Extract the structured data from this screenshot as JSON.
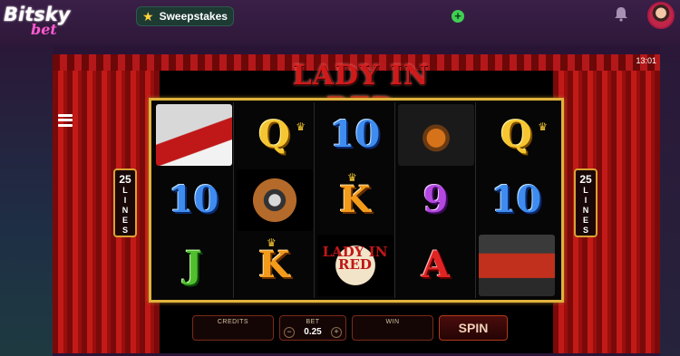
{
  "header": {
    "logo_main": "Bitsky",
    "logo_sub": "bet",
    "sweepstakes_label": "Sweepstakes",
    "add_label": "+",
    "icons": [
      "star-icon",
      "plus-icon",
      "bell-icon",
      "avatar"
    ]
  },
  "game": {
    "title": "LADY IN RED",
    "clock": "13:01",
    "lines_left": {
      "number": "25",
      "word": [
        "L",
        "I",
        "N",
        "E",
        "S"
      ]
    },
    "lines_right": {
      "number": "25",
      "word": [
        "L",
        "I",
        "N",
        "E",
        "S"
      ]
    },
    "reels": [
      [
        {
          "symbol": "roses-symbol",
          "text": ""
        },
        {
          "symbol": "ten",
          "text": "10",
          "color": "blue"
        },
        {
          "symbol": "jack",
          "text": "J",
          "color": "green"
        }
      ],
      [
        {
          "symbol": "queen",
          "text": "Q",
          "color": "gold"
        },
        {
          "symbol": "camera-symbol",
          "text": ""
        },
        {
          "symbol": "king",
          "text": "K",
          "color": "orange"
        }
      ],
      [
        {
          "symbol": "ten",
          "text": "10",
          "color": "blue"
        },
        {
          "symbol": "king",
          "text": "K",
          "color": "orange"
        },
        {
          "symbol": "lady-in-red-logo",
          "text": "LADY IN RED"
        }
      ],
      [
        {
          "symbol": "whisky-symbol",
          "text": ""
        },
        {
          "symbol": "nine",
          "text": "9",
          "color": "purple"
        },
        {
          "symbol": "ace",
          "text": "A",
          "color": "red"
        }
      ],
      [
        {
          "symbol": "queen",
          "text": "Q",
          "color": "gold"
        },
        {
          "symbol": "ten",
          "text": "10",
          "color": "blue"
        },
        {
          "symbol": "lady-singer-symbol",
          "text": ""
        }
      ]
    ],
    "controls": {
      "credits_label": "CREDITS",
      "credits_value": "",
      "bet_label": "BET",
      "bet_value": "0.25",
      "win_label": "WIN",
      "win_value": "",
      "spin_label": "SPIN",
      "bet_minus": "−",
      "bet_plus": "+"
    }
  }
}
